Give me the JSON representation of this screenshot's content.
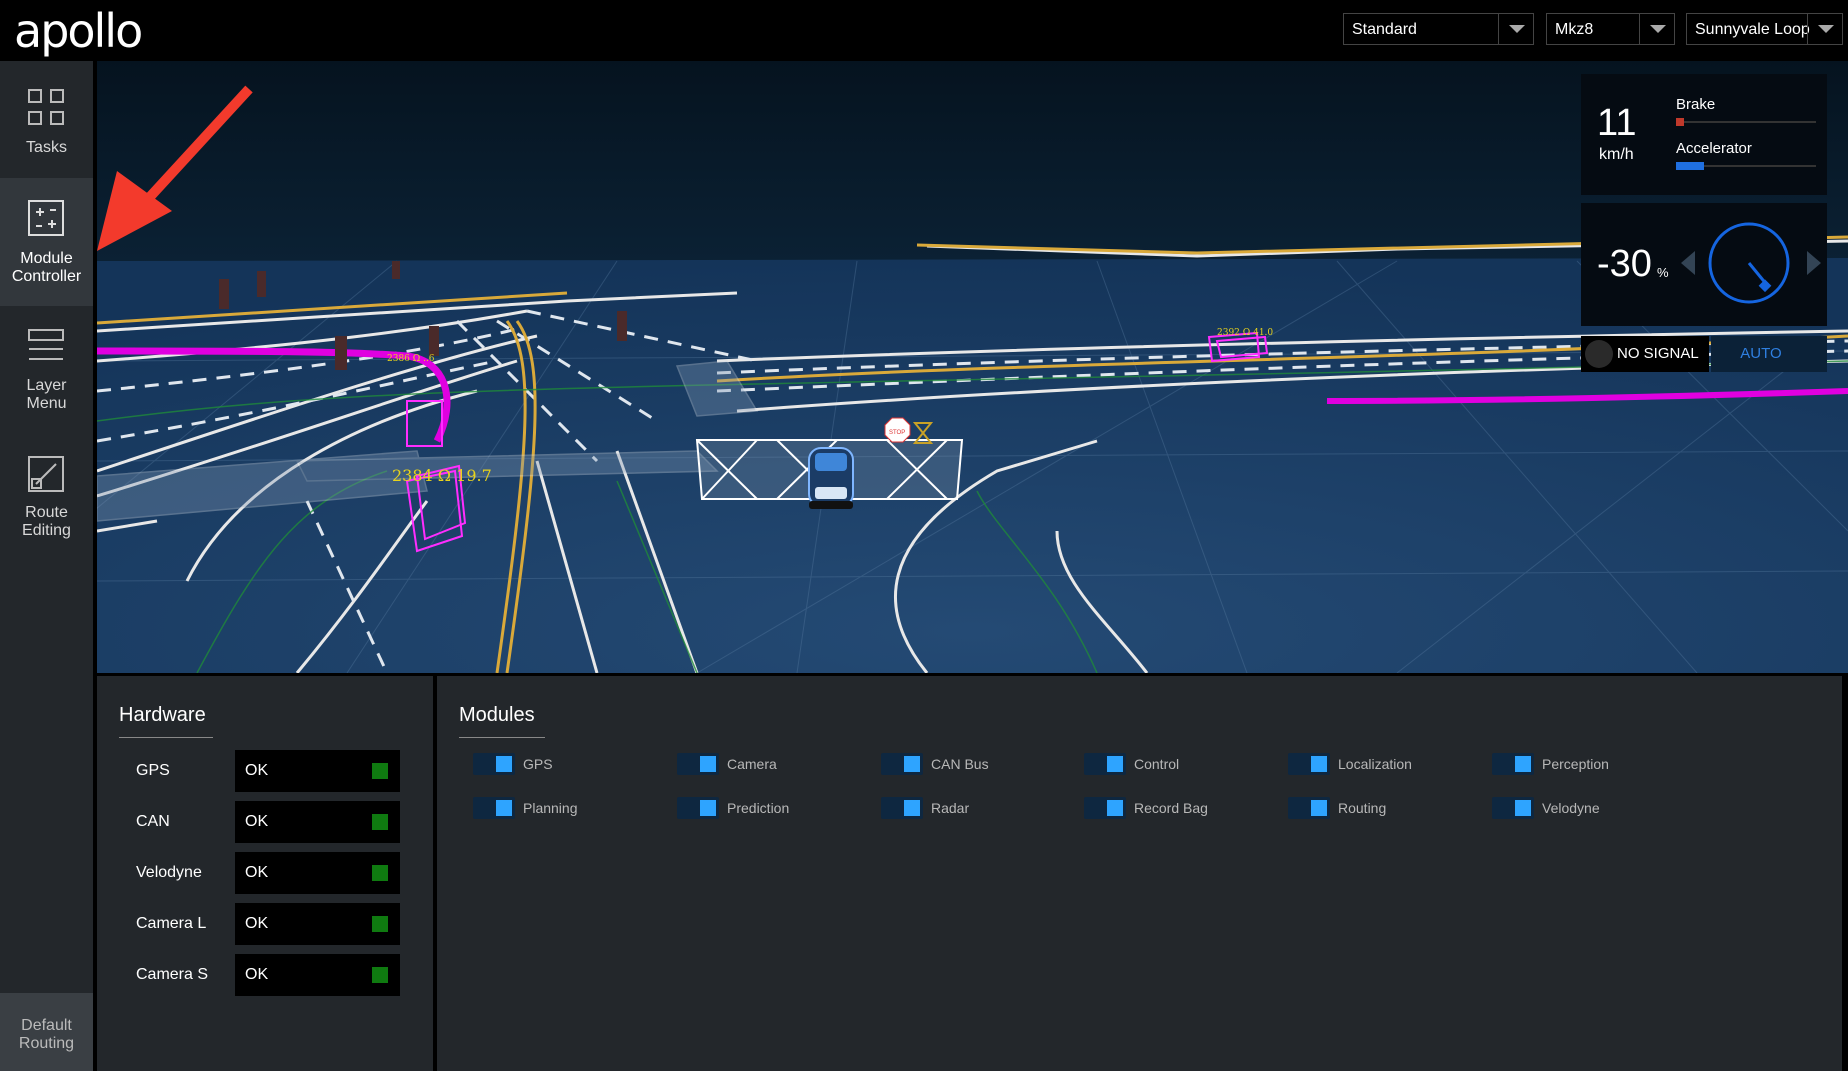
{
  "header": {
    "logo": "apollo",
    "selects": [
      {
        "value": "Standard"
      },
      {
        "value": "Mkz8"
      },
      {
        "value": "Sunnyvale Loop"
      }
    ]
  },
  "sidebar": {
    "items": [
      {
        "label_1": "Tasks",
        "label_2": ""
      },
      {
        "label_1": "Module",
        "label_2": "Controller"
      },
      {
        "label_1": "Layer",
        "label_2": "Menu"
      },
      {
        "label_1": "Route",
        "label_2": "Editing"
      }
    ],
    "bottom": {
      "label_1": "Default",
      "label_2": "Routing"
    }
  },
  "scene": {
    "obstacle_label_1": "2384 Ω 19.7",
    "obstacle_label_2": "2392 Ω 41.0",
    "obstacle_label_3": "2386 Ω ..6",
    "stop_sign": "STOP"
  },
  "dashboard": {
    "speed": "11",
    "speed_unit": "km/h",
    "brake_label": "Brake",
    "brake_fraction": 0.04,
    "accelerator_label": "Accelerator",
    "accelerator_fraction": 0.2,
    "steering": "-30",
    "steering_unit": "%",
    "signal": "NO SIGNAL",
    "mode": "AUTO",
    "colors": {
      "brake": "#c0392b",
      "accelerator": "#1f6fe0",
      "gauge": "#1565e0"
    }
  },
  "hardware": {
    "title": "Hardware",
    "items": [
      {
        "name": "GPS",
        "status": "OK"
      },
      {
        "name": "CAN",
        "status": "OK"
      },
      {
        "name": "Velodyne",
        "status": "OK"
      },
      {
        "name": "Camera L",
        "status": "OK"
      },
      {
        "name": "Camera S",
        "status": "OK"
      }
    ]
  },
  "modules": {
    "title": "Modules",
    "items": [
      {
        "name": "GPS"
      },
      {
        "name": "Camera"
      },
      {
        "name": "CAN Bus"
      },
      {
        "name": "Control"
      },
      {
        "name": "Localization"
      },
      {
        "name": "Perception"
      },
      {
        "name": "Planning"
      },
      {
        "name": "Prediction"
      },
      {
        "name": "Radar"
      },
      {
        "name": "Record Bag"
      },
      {
        "name": "Routing"
      },
      {
        "name": "Velodyne"
      }
    ]
  }
}
